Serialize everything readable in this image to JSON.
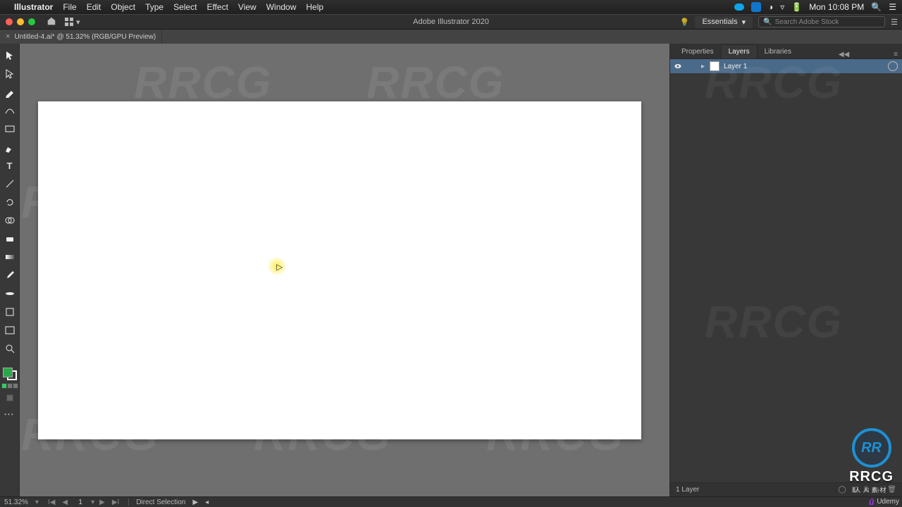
{
  "menubar": {
    "appname": "Illustrator",
    "items": [
      "File",
      "Edit",
      "Object",
      "Type",
      "Select",
      "Effect",
      "View",
      "Window",
      "Help"
    ],
    "right_time": "Mon 10:08 PM"
  },
  "apptoolbar": {
    "title": "Adobe Illustrator 2020",
    "workspace_label": "Essentials",
    "stock_placeholder": "Search Adobe Stock"
  },
  "doctab": {
    "label": "Untitled-4.ai* @ 51.32% (RGB/GPU Preview)"
  },
  "panels": {
    "tabs": [
      "Properties",
      "Layers",
      "Libraries"
    ],
    "active_tab_index": 1,
    "layer_name": "Layer 1",
    "footer_count": "1 Layer"
  },
  "statusbar": {
    "zoom": "51.32%",
    "artboard_index": "1",
    "tool_name": "Direct Selection"
  },
  "colors": {
    "fill": "#2aa74a"
  },
  "overlay": {
    "logo_text": "RRCG",
    "logo_sub": "人人素材"
  },
  "udemy_label": "Udemy"
}
